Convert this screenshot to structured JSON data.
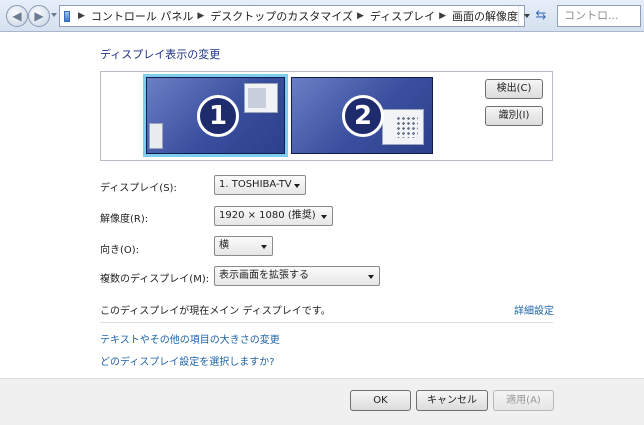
{
  "address_bar": {
    "breadcrumbs": [
      {
        "label": "コントロール パネル"
      },
      {
        "label": "デスクトップのカスタマイズ"
      },
      {
        "label": "ディスプレイ"
      },
      {
        "label": "画面の解像度"
      }
    ],
    "search_placeholder": "コントロ..."
  },
  "heading": "ディスプレイ表示の変更",
  "monitors": [
    {
      "number": "1",
      "selected": true
    },
    {
      "number": "2",
      "selected": false
    }
  ],
  "buttons": {
    "detect": "検出(C)",
    "identify": "識別(I)"
  },
  "settings": {
    "display": {
      "label": "ディスプレイ(S):",
      "value": "1. TOSHIBA-TV"
    },
    "resolution": {
      "label": "解像度(R):",
      "value": "1920 × 1080 (推奨)"
    },
    "orientation": {
      "label": "向き(O):",
      "value": "横"
    },
    "multiple_displays": {
      "label": "複数のディスプレイ(M):",
      "value": "表示画面を拡張する"
    }
  },
  "main_display_note": "このディスプレイが現在メイン ディスプレイです。",
  "links": {
    "advanced": "詳細設定",
    "text_size": "テキストやその他の項目の大きさの変更",
    "which_settings": "どのディスプレイ設定を選択しますか?"
  },
  "footer": {
    "ok": "OK",
    "cancel": "キャンセル",
    "apply": "適用(A)"
  },
  "colors": {
    "heading": "#1e3287",
    "link": "#1e63a8",
    "monitor_fill": "#3a4f9e",
    "selected_outline": "#7ecdf0"
  }
}
